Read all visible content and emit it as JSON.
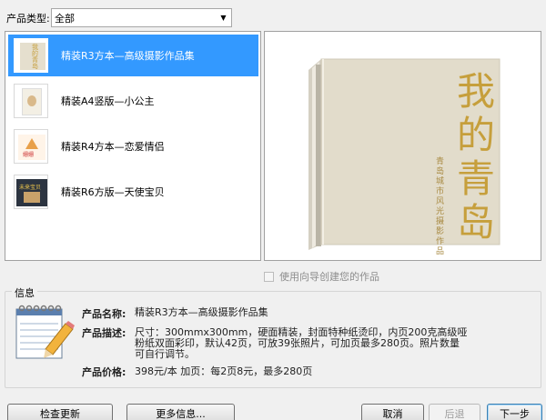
{
  "filter": {
    "label": "产品类型:",
    "selected": "全部"
  },
  "products": [
    {
      "name": "精装R3方本—高级摄影作品集",
      "selected": true,
      "thumb_text": "我的青岛"
    },
    {
      "name": "精装A4竖版—小公主",
      "selected": false,
      "thumb_text": ""
    },
    {
      "name": "精装R4方本—恋爱情侣",
      "selected": false,
      "thumb_text": "姗姗"
    },
    {
      "name": "精装R6方版—天使宝贝",
      "selected": false,
      "thumb_text": "未来宝贝"
    }
  ],
  "preview": {
    "cover_title": "我的青岛",
    "cover_subtitle": "青岛城市风光摄影作品"
  },
  "wizard_checkbox": {
    "label": "使用向导创建您的作品",
    "checked": false
  },
  "info": {
    "group_title": "信息",
    "name_label": "产品名称:",
    "name_value": "精装R3方本—高级摄影作品集",
    "desc_label": "产品描述:",
    "desc_line1": "尺寸：300mmx300mm，硬面精装，封面特种纸烫印，内页200克高级哑",
    "desc_line2": "粉纸双面彩印，默认42页，可放39张照片，可加页最多280页。照片数量",
    "desc_line3": "可自行调节。",
    "price_label": "产品价格:",
    "price_value": "398元/本 加页：每2页8元，最多280页"
  },
  "buttons": {
    "check_update": "检查更新",
    "more_info": "更多信息...",
    "cancel": "取消",
    "back": "后退",
    "next": "下一步"
  },
  "colors": {
    "selection": "#3399ff",
    "cover": "#e2dccb",
    "cover_text": "#c69f3c"
  }
}
